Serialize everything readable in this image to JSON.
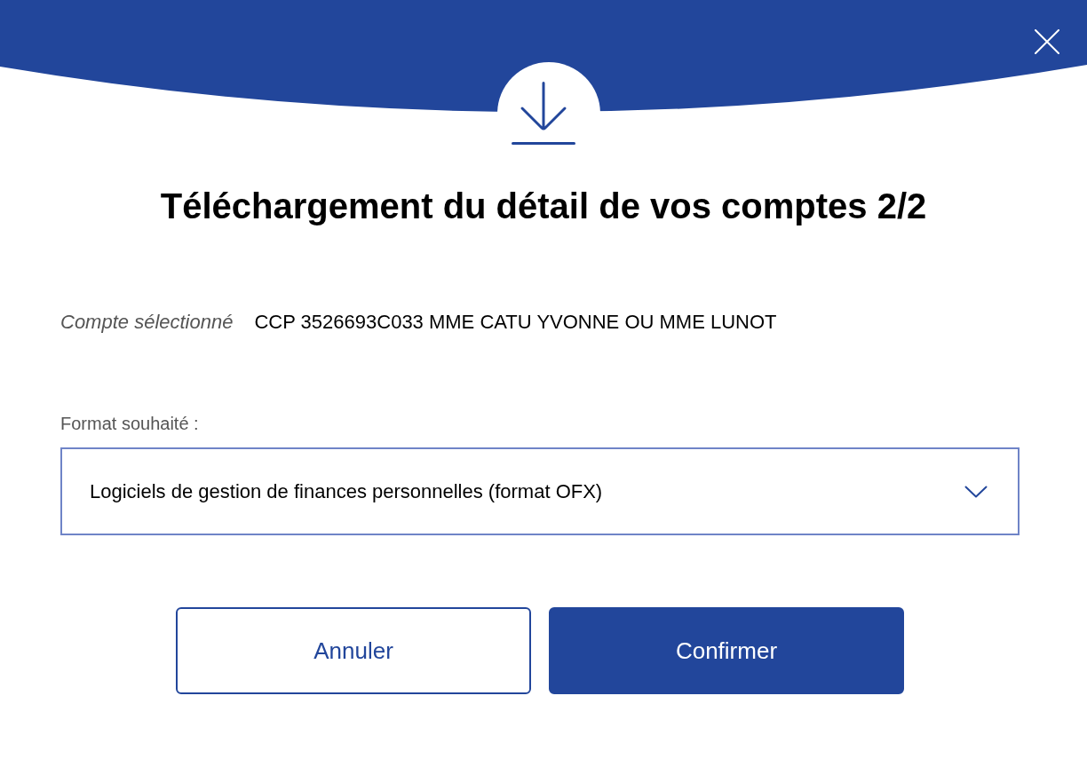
{
  "dialog": {
    "title": "Téléchargement du détail de vos comptes 2/2",
    "selected_account": {
      "label": "Compte sélectionné",
      "value": "CCP 3526693C033 MME CATU YVONNE OU MME LUNOT"
    },
    "format_field": {
      "label": "Format souhaité :",
      "value": "Logiciels de gestion de finances personnelles (format OFX)"
    },
    "buttons": [
      {
        "label": "Annuler",
        "kind": "secondary"
      },
      {
        "label": "Confirmer",
        "kind": "primary"
      }
    ]
  }
}
